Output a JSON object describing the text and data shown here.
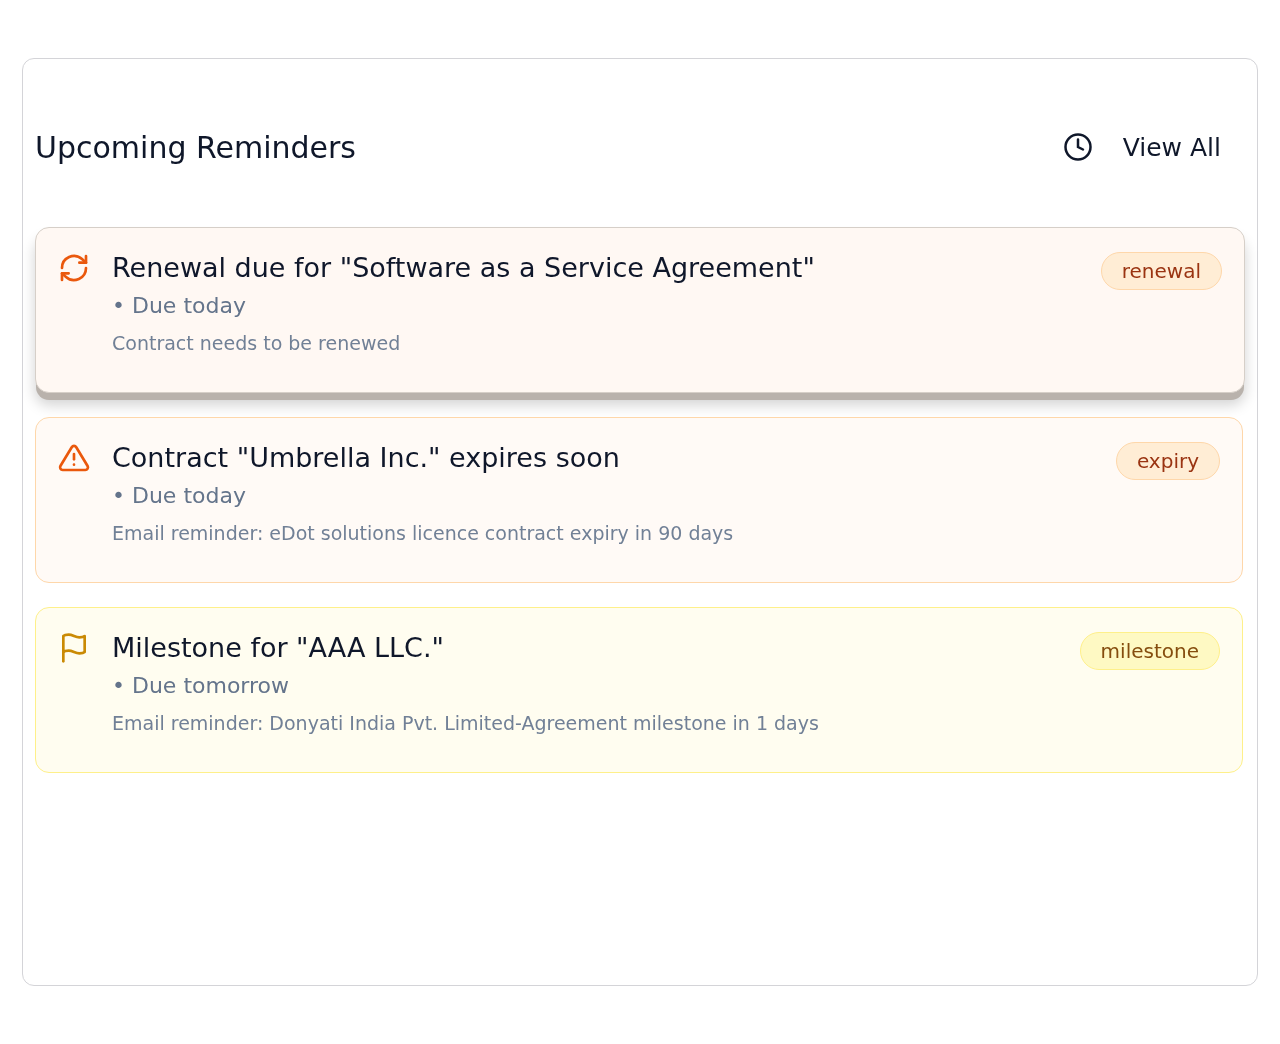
{
  "panel": {
    "title": "Upcoming Reminders",
    "view_all": "View All"
  },
  "reminders": [
    {
      "kind": "renewal",
      "raised": true,
      "title": "Renewal due for \"Software as a Service Agreement\"",
      "due": "• Due today",
      "description": "Contract needs to be renewed",
      "tag": "renewal"
    },
    {
      "kind": "expiry",
      "raised": false,
      "title": "Contract \"Umbrella Inc.\" expires soon",
      "due": "• Due today",
      "description": "Email reminder: eDot solutions licence contract expiry in 90 days",
      "tag": "expiry"
    },
    {
      "kind": "milestone",
      "raised": false,
      "title": "Milestone for \"AAA LLC.\"",
      "due": "• Due tomorrow",
      "description": "Email reminder: Donyati India Pvt. Limited-Agreement milestone in 1 days",
      "tag": "milestone"
    }
  ]
}
